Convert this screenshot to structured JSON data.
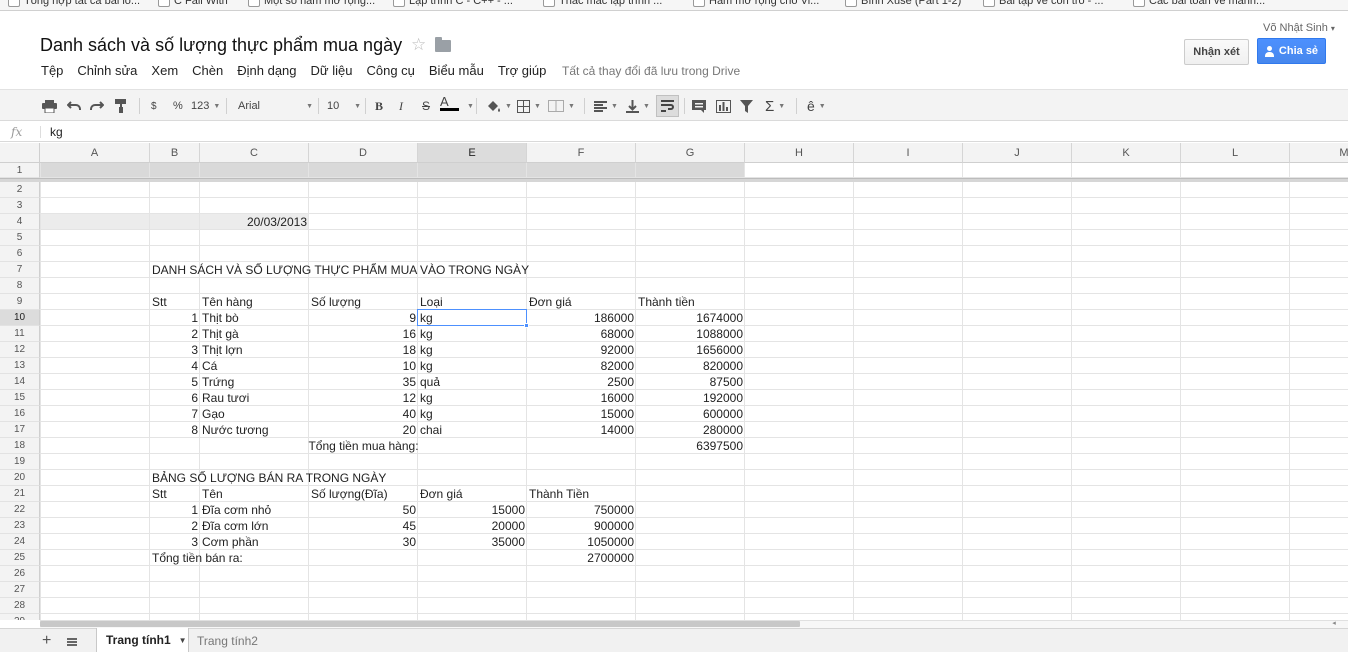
{
  "bookmarks": [
    "Tổng hợp tất cả bài lồ...",
    "C Fall With",
    "Một số hàm mở rộng...",
    "Lập trình C - C++ - ...",
    "Thắc mắc lập trình ...",
    "Hàm mở rộng cho Vi...",
    "Bình Xuse (Part 1-2)",
    "Bài tập về con trỏ - ...",
    "Các bài toán về mảnh..."
  ],
  "header": {
    "title": "Danh sách và số lượng thực phẩm mua ngày",
    "user": "Võ Nhật Sinh",
    "comment_label": "Nhận xét",
    "share_label": "Chia sẻ",
    "save_status": "Tất cả thay đổi đã lưu trong Drive"
  },
  "menu": [
    "Tệp",
    "Chỉnh sửa",
    "Xem",
    "Chèn",
    "Định dạng",
    "Dữ liệu",
    "Công cụ",
    "Biểu mẫu",
    "Trợ giúp"
  ],
  "toolbar": {
    "currency": "$",
    "percent": "%",
    "number_format": "123",
    "font": "Arial",
    "font_size": "10",
    "bold": "B",
    "italic": "I",
    "strike": "S",
    "text_color_letter": "A",
    "sigma": "Σ",
    "input_tool": "ê"
  },
  "formula_bar": {
    "fx": "fx",
    "value": "kg"
  },
  "columns": [
    "A",
    "B",
    "C",
    "D",
    "E",
    "F",
    "G",
    "H",
    "I",
    "J",
    "K",
    "L",
    "M"
  ],
  "active_column": "E",
  "active_row": "10",
  "rows": [
    "1",
    "2",
    "3",
    "4",
    "5",
    "6",
    "7",
    "8",
    "9",
    "10",
    "11",
    "12",
    "13",
    "14",
    "15",
    "16",
    "17",
    "18",
    "19",
    "20",
    "21",
    "22",
    "23",
    "24",
    "25",
    "26",
    "27",
    "28",
    "29"
  ],
  "sheet": {
    "date": "20/03/2013",
    "title1": "DANH SÁCH VÀ SỐ LƯỢNG THỰC PHẨM MUA VÀO TRONG NGÀY",
    "t1_headers": {
      "stt": "Stt",
      "name": "Tên hàng",
      "qty": "Số lượng",
      "type": "Loại",
      "price": "Đơn giá",
      "total": "Thành tiền"
    },
    "t1_rows": [
      {
        "stt": "1",
        "name": "Thịt bò",
        "qty": "9",
        "type": "kg",
        "price": "186000",
        "total": "1674000"
      },
      {
        "stt": "2",
        "name": "Thịt gà",
        "qty": "16",
        "type": "kg",
        "price": "68000",
        "total": "1088000"
      },
      {
        "stt": "3",
        "name": "Thịt lợn",
        "qty": "18",
        "type": "kg",
        "price": "92000",
        "total": "1656000"
      },
      {
        "stt": "4",
        "name": "Cá",
        "qty": "10",
        "type": "kg",
        "price": "82000",
        "total": "820000"
      },
      {
        "stt": "5",
        "name": "Trứng",
        "qty": "35",
        "type": "quả",
        "price": "2500",
        "total": "87500"
      },
      {
        "stt": "6",
        "name": "Rau tươi",
        "qty": "12",
        "type": "kg",
        "price": "16000",
        "total": "192000"
      },
      {
        "stt": "7",
        "name": "Gạo",
        "qty": "40",
        "type": "kg",
        "price": "15000",
        "total": "600000"
      },
      {
        "stt": "8",
        "name": "Nước tương",
        "qty": "20",
        "type": "chai",
        "price": "14000",
        "total": "280000"
      }
    ],
    "t1_total_label": "Tổng tiền mua hàng:",
    "t1_total_value": "6397500",
    "title2": "BẢNG SỐ LƯỢNG BÁN RA TRONG NGÀY",
    "t2_headers": {
      "stt": "Stt",
      "name": "Tên",
      "qty": "Số lượng(Đĩa)",
      "price": "Đơn giá",
      "total": "Thành Tiền"
    },
    "t2_rows": [
      {
        "stt": "1",
        "name": "Đĩa cơm nhỏ",
        "qty": "50",
        "price": "15000",
        "total": "750000"
      },
      {
        "stt": "2",
        "name": "Đĩa cơm lớn",
        "qty": "45",
        "price": "20000",
        "total": "900000"
      },
      {
        "stt": "3",
        "name": "Cơm phần",
        "qty": "30",
        "price": "35000",
        "total": "1050000"
      }
    ],
    "t2_total_label": "Tổng tiền bán ra:",
    "t2_total_value": "2700000"
  },
  "tabs": {
    "active": "Trang tính1",
    "other": "Trang tính2"
  },
  "icons": [
    "star-icon",
    "folder-icon",
    "print-icon",
    "undo-icon",
    "redo-icon",
    "paint-format-icon",
    "fill-color-icon",
    "borders-icon",
    "merge-icon",
    "align-icon",
    "valign-icon",
    "wrap-icon",
    "comment-icon",
    "chart-icon",
    "filter-icon",
    "functions-icon"
  ]
}
